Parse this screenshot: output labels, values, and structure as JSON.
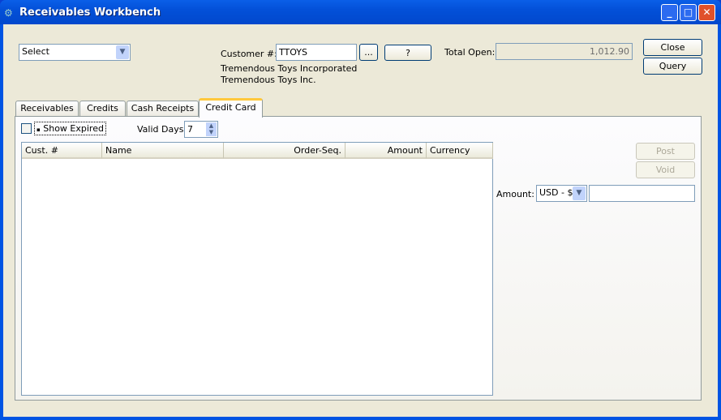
{
  "window": {
    "title": "Receivables Workbench"
  },
  "selector": {
    "value": "Select"
  },
  "customer": {
    "label": "Customer #:",
    "value": "TTOYS",
    "lookup_label": "...",
    "help_label": "?",
    "name1": "Tremendous Toys Incorporated",
    "name2": "Tremendous Toys Inc."
  },
  "total_open": {
    "label": "Total Open:",
    "value": "1,012.90"
  },
  "buttons": {
    "close": "Close",
    "query": "Query",
    "post": "Post",
    "void": "Void"
  },
  "tabs": [
    {
      "label": "Receivables"
    },
    {
      "label": "Credits"
    },
    {
      "label": "Cash Receipts"
    },
    {
      "label": "Credit Card",
      "active": true
    }
  ],
  "filters": {
    "show_expired": "Show Expired",
    "show_expired_checked": false,
    "valid_days_label": "Valid Days:",
    "valid_days": "7"
  },
  "table": {
    "columns": [
      "Cust. #",
      "Name",
      "Order-Seq.",
      "Amount",
      "Currency"
    ],
    "rows": []
  },
  "amount": {
    "label": "Amount:",
    "currency": "USD - $",
    "value": ""
  }
}
